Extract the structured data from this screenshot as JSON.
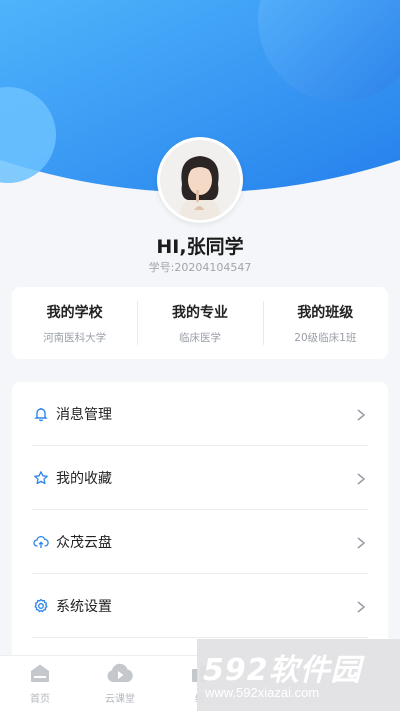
{
  "profile": {
    "greeting": "HI,张同学",
    "student_id": "学号:20204104547"
  },
  "info": [
    {
      "title": "我的学校",
      "value": "河南医科大学"
    },
    {
      "title": "我的专业",
      "value": "临床医学"
    },
    {
      "title": "我的班级",
      "value": "20级临床1班"
    }
  ],
  "menu": [
    {
      "label": "消息管理",
      "icon": "bell-icon"
    },
    {
      "label": "我的收藏",
      "icon": "star-icon"
    },
    {
      "label": "众茂云盘",
      "icon": "cloud-upload-icon"
    },
    {
      "label": "系统设置",
      "icon": "gear-icon"
    }
  ],
  "tabs": [
    {
      "label": "首页",
      "icon": "home-icon"
    },
    {
      "label": "云课堂",
      "icon": "play-cloud-icon"
    },
    {
      "label": "练",
      "icon": "practice-icon"
    }
  ],
  "watermark": {
    "brand": "592软件园",
    "url": "www.592xiazai.com"
  },
  "colors": {
    "accent": "#2f8cf2",
    "icon": "#2e86e8"
  }
}
